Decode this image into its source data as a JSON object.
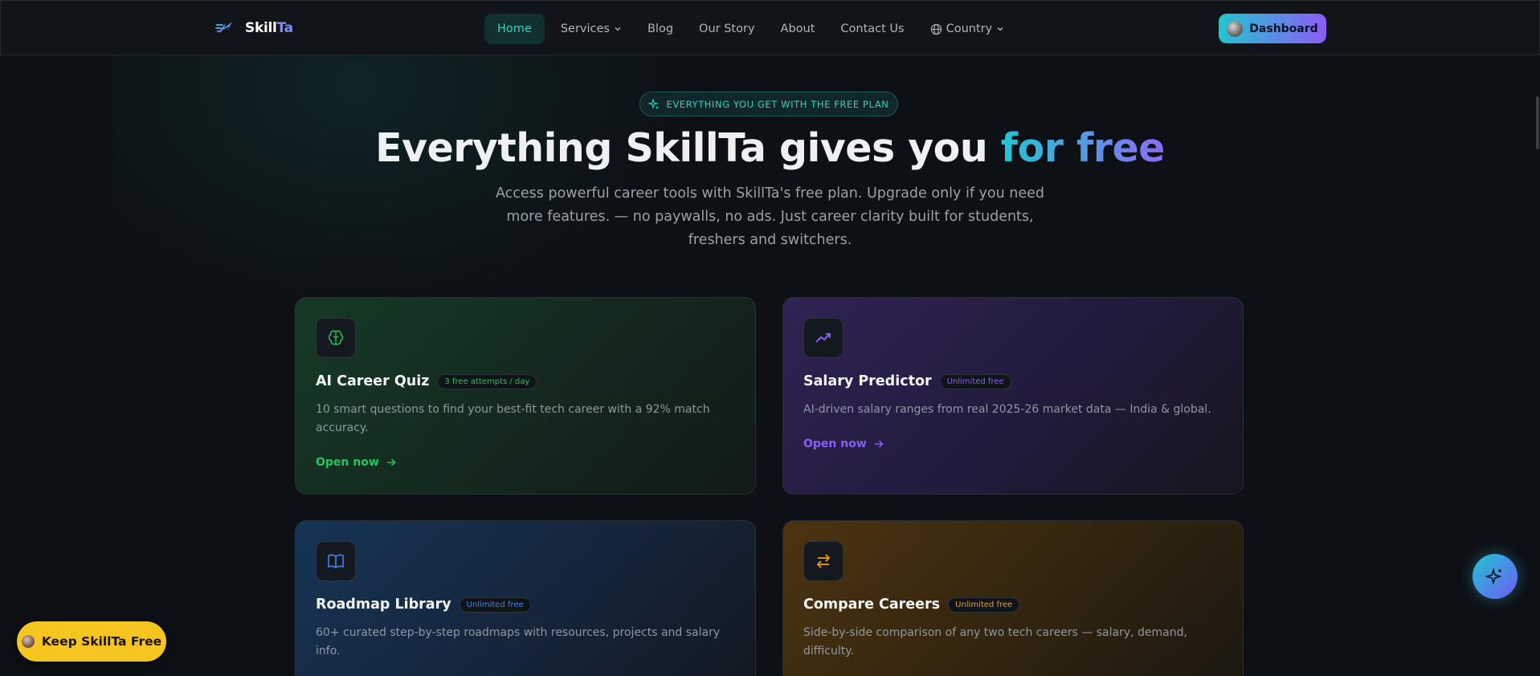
{
  "brand": {
    "name_main": "Skill",
    "name_accent": "Ta",
    "logo_icon": "skillta-logo-icon"
  },
  "nav": {
    "items": [
      {
        "label": "Home",
        "active": true
      },
      {
        "label": "Services",
        "dropdown": true
      },
      {
        "label": "Blog"
      },
      {
        "label": "Our Story"
      },
      {
        "label": "About"
      },
      {
        "label": "Contact Us"
      },
      {
        "label": "Country",
        "dropdown": true,
        "icon": "globe-icon"
      }
    ],
    "dashboard_label": "Dashboard"
  },
  "hero": {
    "pill": "EVERYTHING YOU GET WITH THE FREE PLAN",
    "title_main": "Everything SkillTa gives you ",
    "title_accent": "for free",
    "subtitle": "Access powerful career tools with SkillTa's free plan. Upgrade only if you need more features. — no paywalls, no ads. Just career clarity built for students, freshers and switchers."
  },
  "cards": [
    {
      "title": "AI Career Quiz",
      "badge": "3 free attempts / day",
      "description": "10 smart questions to find your best-fit tech career with a 92% match accuracy.",
      "link": "Open now",
      "icon": "brain-icon",
      "accent": "#22c55e"
    },
    {
      "title": "Salary Predictor",
      "badge": "Unlimited free",
      "description": "AI-driven salary ranges from real 2025-26 market data — India & global.",
      "link": "Open now",
      "icon": "trending-up-icon",
      "accent": "#8b5cf6"
    },
    {
      "title": "Roadmap Library",
      "badge": "Unlimited free",
      "description": "60+ curated step-by-step roadmaps with resources, projects and salary info.",
      "icon": "book-open-icon",
      "accent": "#3b82f6"
    },
    {
      "title": "Compare Careers",
      "badge": "Unlimited free",
      "description": "Side-by-side comparison of any two tech careers — salary, demand, difficulty.",
      "icon": "arrows-swap-icon",
      "accent": "#f59e0b"
    }
  ],
  "floating": {
    "keep_label": "Keep SkillTa Free",
    "assistant_icon": "sparkles-icon"
  },
  "colors": {
    "teal": "#2dd4bf",
    "violet": "#8b5cf6",
    "yellow": "#f7c51f",
    "background": "#0d1014"
  }
}
